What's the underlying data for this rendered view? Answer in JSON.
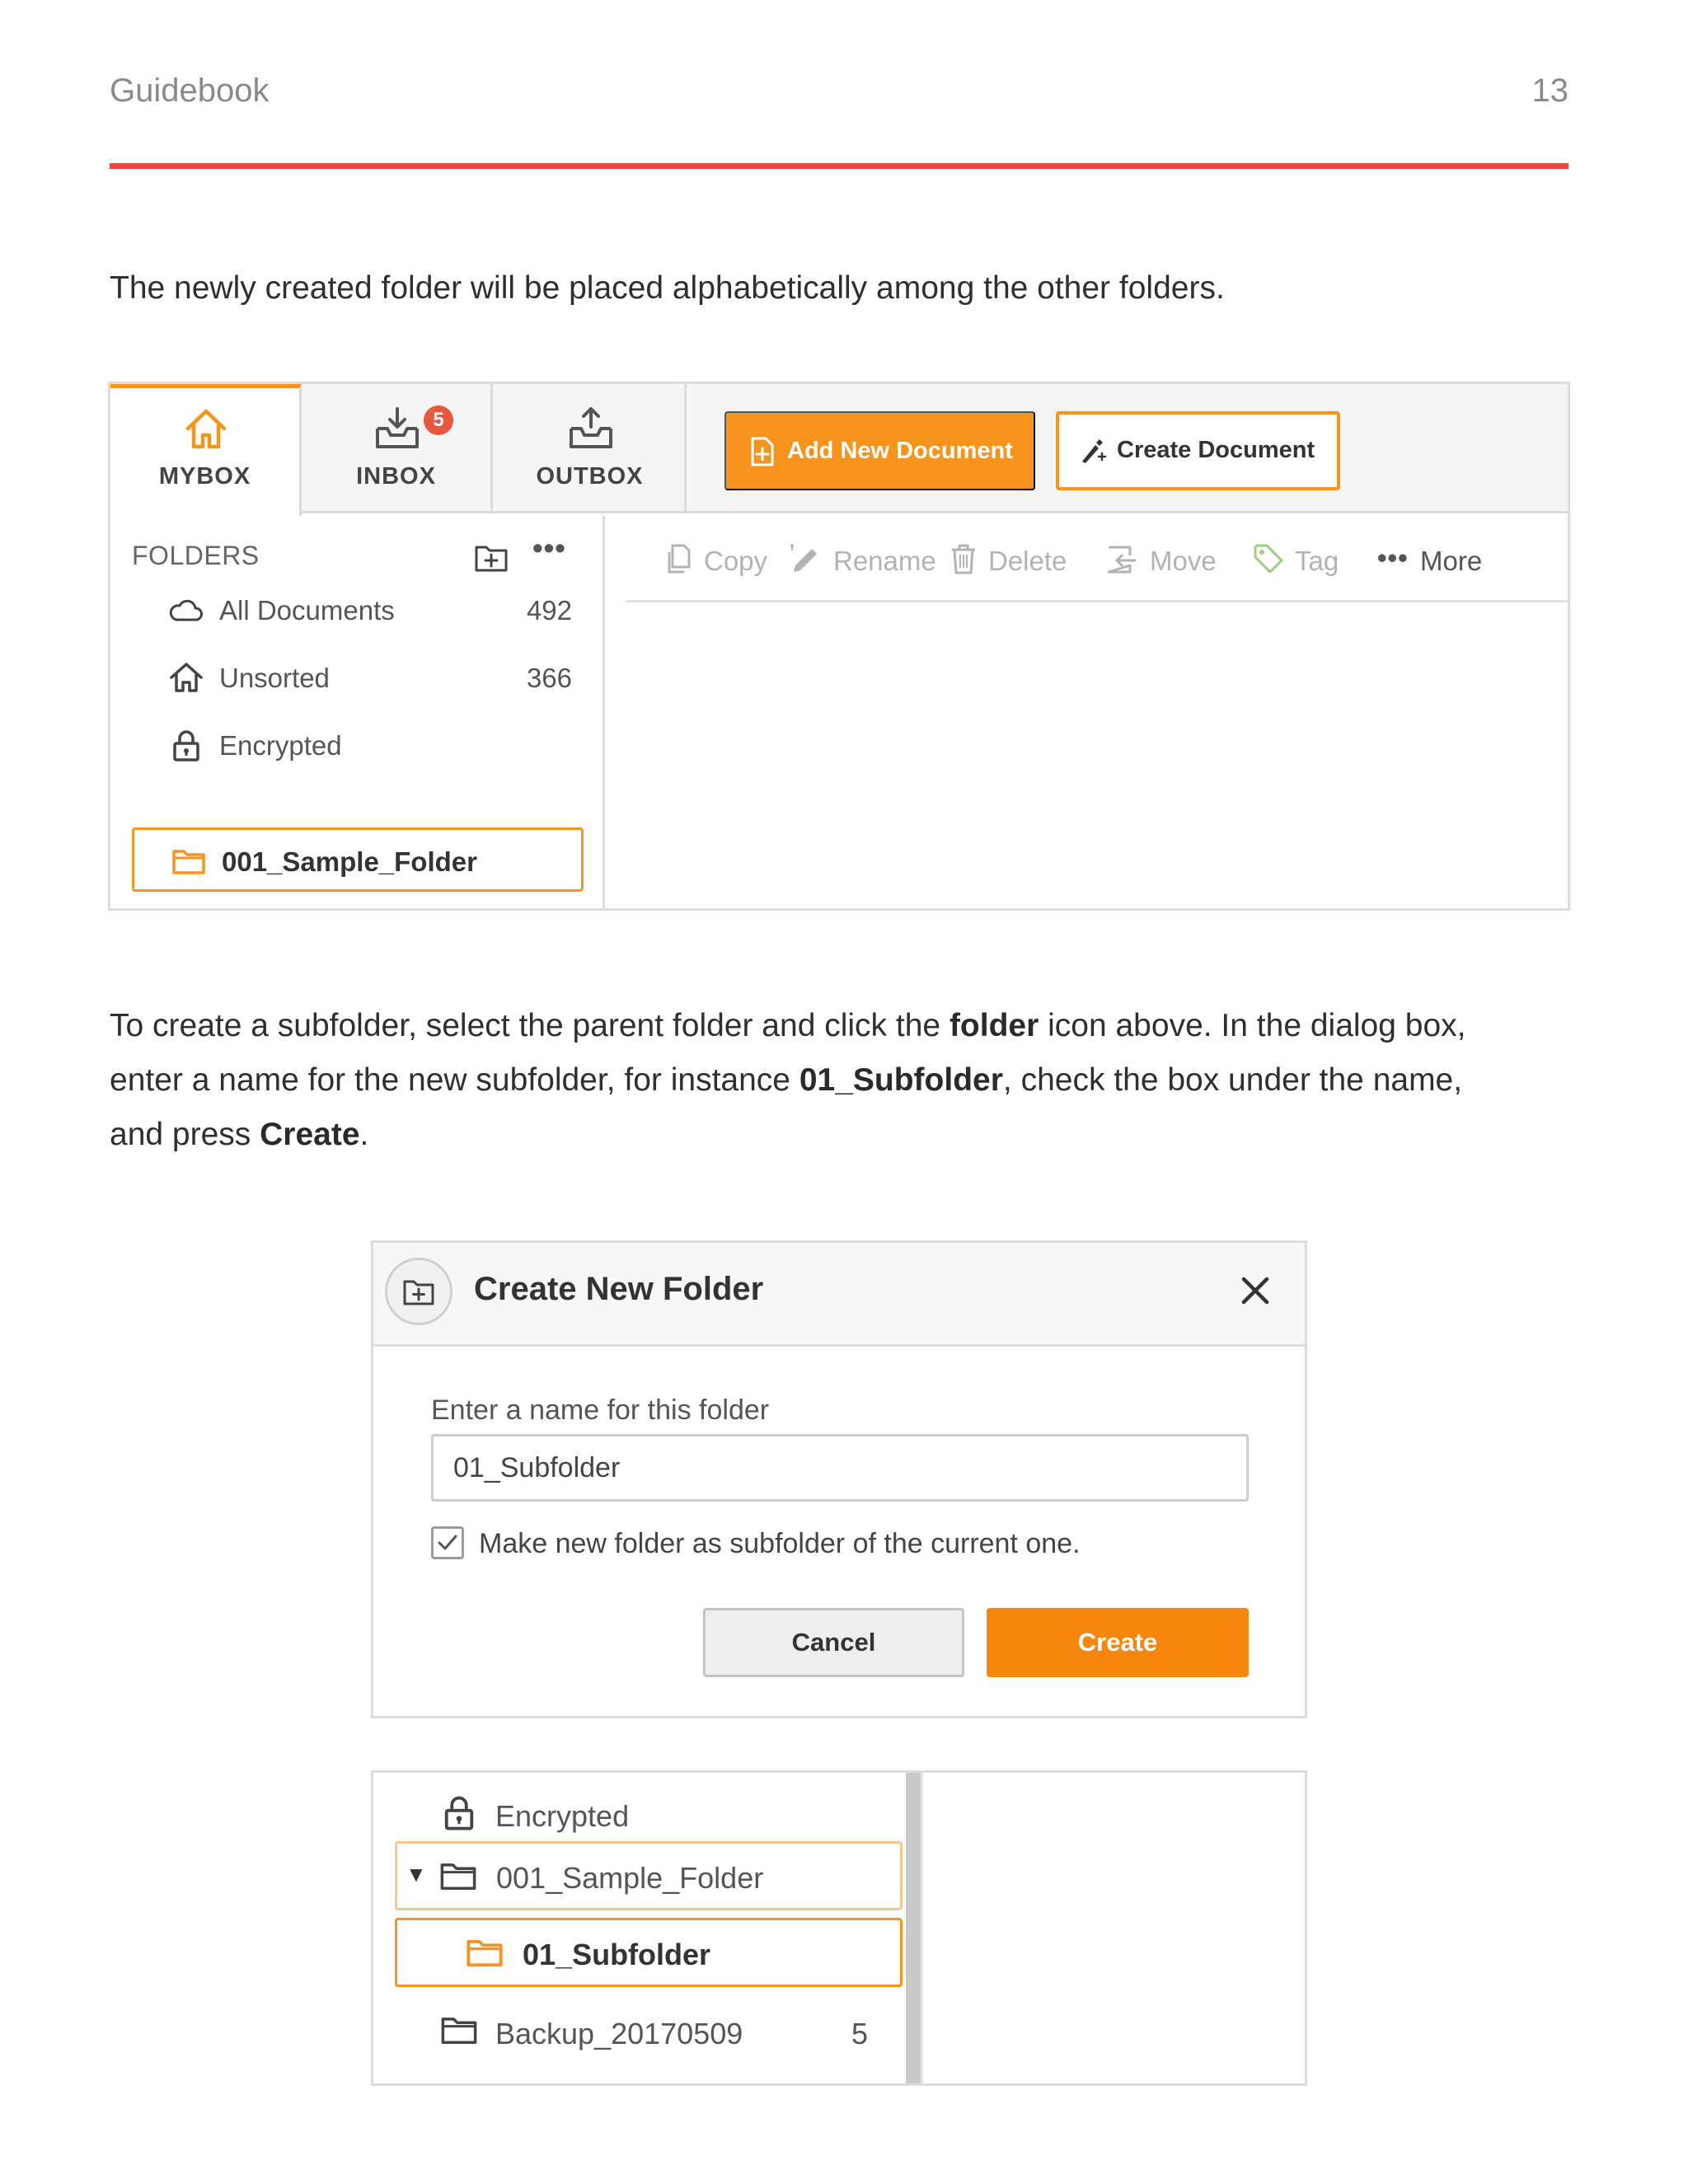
{
  "header": {
    "title": "Guidebook",
    "page_number": "13"
  },
  "intro_text": "The newly created folder will be placed alphabetically among the other folders.",
  "app": {
    "tabs": [
      {
        "label": "MYBOX",
        "icon": "home-icon",
        "active": true
      },
      {
        "label": "INBOX",
        "icon": "inbox-icon",
        "badge": "5"
      },
      {
        "label": "OUTBOX",
        "icon": "outbox-icon"
      }
    ],
    "add_document_label": "Add New Document",
    "create_document_label": "Create Document",
    "folders_label": "FOLDERS",
    "folders_more": "•••",
    "folders": [
      {
        "label": "All Documents",
        "count": "492",
        "icon": "cloud-icon"
      },
      {
        "label": "Unsorted",
        "count": "366",
        "icon": "house-icon"
      },
      {
        "label": "Encrypted",
        "count": "",
        "icon": "lock-icon"
      }
    ],
    "selected_folder": "001_Sample_Folder",
    "toolbar": {
      "copy": "Copy",
      "rename": "Rename",
      "delete": "Delete",
      "move": "Move",
      "tag": "Tag",
      "more_dots": "•••",
      "more": "More"
    },
    "accent_color": "#f7941d"
  },
  "instruction": {
    "part1": "To create a subfolder, select the parent folder and click the ",
    "bold1": "folder",
    "part2": " icon above. In the dialog box,",
    "part3": "enter a name for the new subfolder, for instance ",
    "bold2": "01_Subfolder",
    "part4": ", check the box under the name,",
    "part5": "and press ",
    "bold3": "Create",
    "part6": "."
  },
  "dialog": {
    "title": "Create New Folder",
    "field_label": "Enter a name for this folder",
    "field_value": "01_Subfolder",
    "checkbox_label": "Make new folder as subfolder of the current one.",
    "checkbox_checked": true,
    "cancel_label": "Cancel",
    "create_label": "Create"
  },
  "tree": {
    "encrypted": "Encrypted",
    "caret": "▼",
    "parent": "001_Sample_Folder",
    "child": "01_Subfolder",
    "backup": "Backup_20170509",
    "backup_count": "5"
  }
}
